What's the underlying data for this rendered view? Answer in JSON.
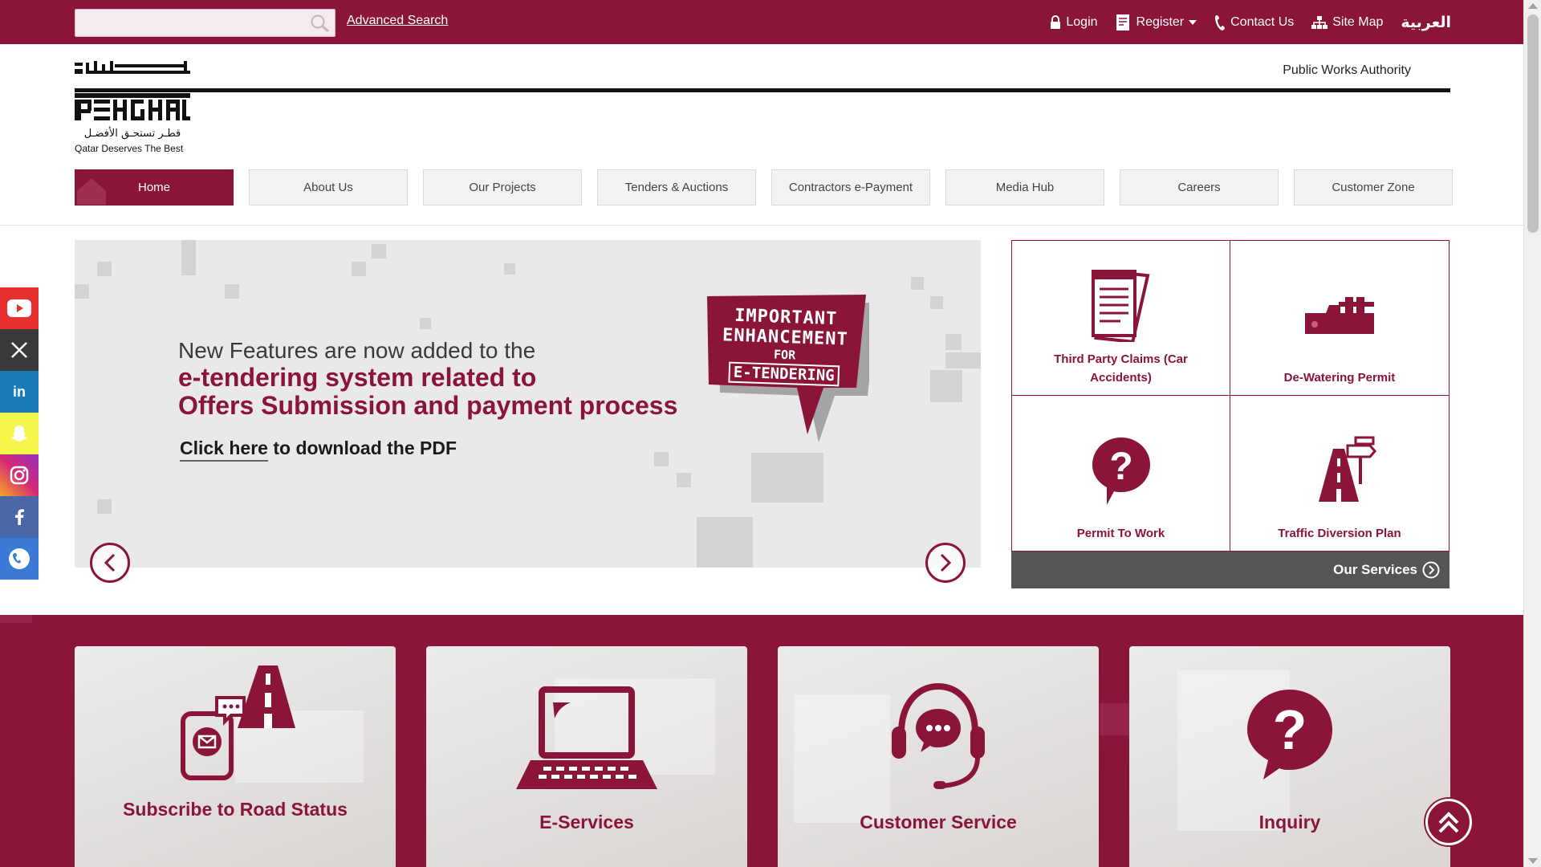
{
  "topbar": {
    "search_placeholder": "",
    "advanced_search": "Advanced Search",
    "links": {
      "login": "Login",
      "register": "Register",
      "contact": "Contact Us",
      "sitemap": "Site Map",
      "arabic": "العربية"
    }
  },
  "header": {
    "tagline_arabic": "قطـر تستحـق الأفضـل",
    "tagline": "Qatar Deserves The Best",
    "authority": "Public Works Authority"
  },
  "nav": {
    "items": [
      "Home",
      "About Us",
      "Our Projects",
      "Tenders & Auctions",
      "Contractors e-Payment",
      "Media Hub",
      "Careers",
      "Customer Zone"
    ],
    "active": "Home"
  },
  "slider": {
    "line1": "New Features are now added to the",
    "line2": "e-tendering system related to",
    "line3": "Offers Submission and payment process",
    "cta_link": "Click here",
    "cta_rest": " to download the PDF",
    "badge": {
      "line1": "IMPORTANT",
      "line2": "ENHANCEMENT",
      "line3": "FOR",
      "line4": "E-TENDERING"
    }
  },
  "services": {
    "items": [
      "Third Party Claims (Car Accidents)",
      "De-Watering Permit",
      "Permit To Work",
      "Traffic Diversion Plan"
    ],
    "footer": "Our Services"
  },
  "social": [
    "youtube",
    "x",
    "linkedin",
    "snapchat",
    "instagram",
    "facebook",
    "phone"
  ],
  "cards": [
    "Subscribe to Road Status",
    "E-Services",
    "Customer Service",
    "Inquiry"
  ],
  "colors": {
    "brand": "#8a1538",
    "services_footer": "#555558"
  }
}
